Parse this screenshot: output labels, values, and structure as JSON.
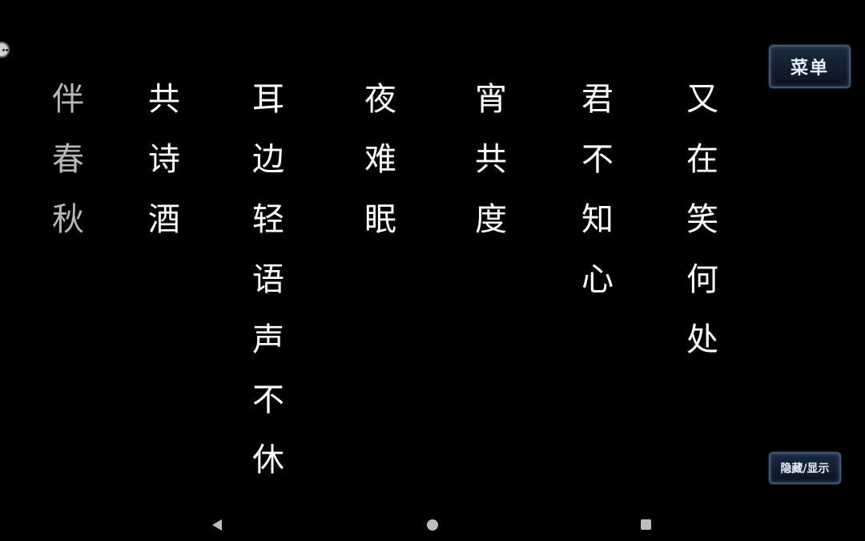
{
  "buttons": {
    "menu_label": "菜单",
    "toggle_label": "隐藏/显示"
  },
  "poem": {
    "columns": [
      [
        "又",
        "在",
        "笑",
        "何",
        "处"
      ],
      [
        "君",
        "不",
        "知",
        "心"
      ],
      [
        "宵",
        "共",
        "度"
      ],
      [
        "夜",
        "难",
        "眠"
      ],
      [
        "耳",
        "边",
        "轻",
        "语",
        "声",
        "不",
        "休"
      ],
      [
        "共",
        "诗",
        "酒"
      ],
      [
        "伴",
        "春",
        "秋"
      ]
    ]
  },
  "icons": {
    "corner": "face-icon",
    "nav_back": "back-triangle-icon",
    "nav_home": "home-circle-icon",
    "nav_recent": "recent-square-icon"
  },
  "colors": {
    "background": "#000000",
    "text": "#ffffff",
    "button_border": "#3a5878"
  }
}
